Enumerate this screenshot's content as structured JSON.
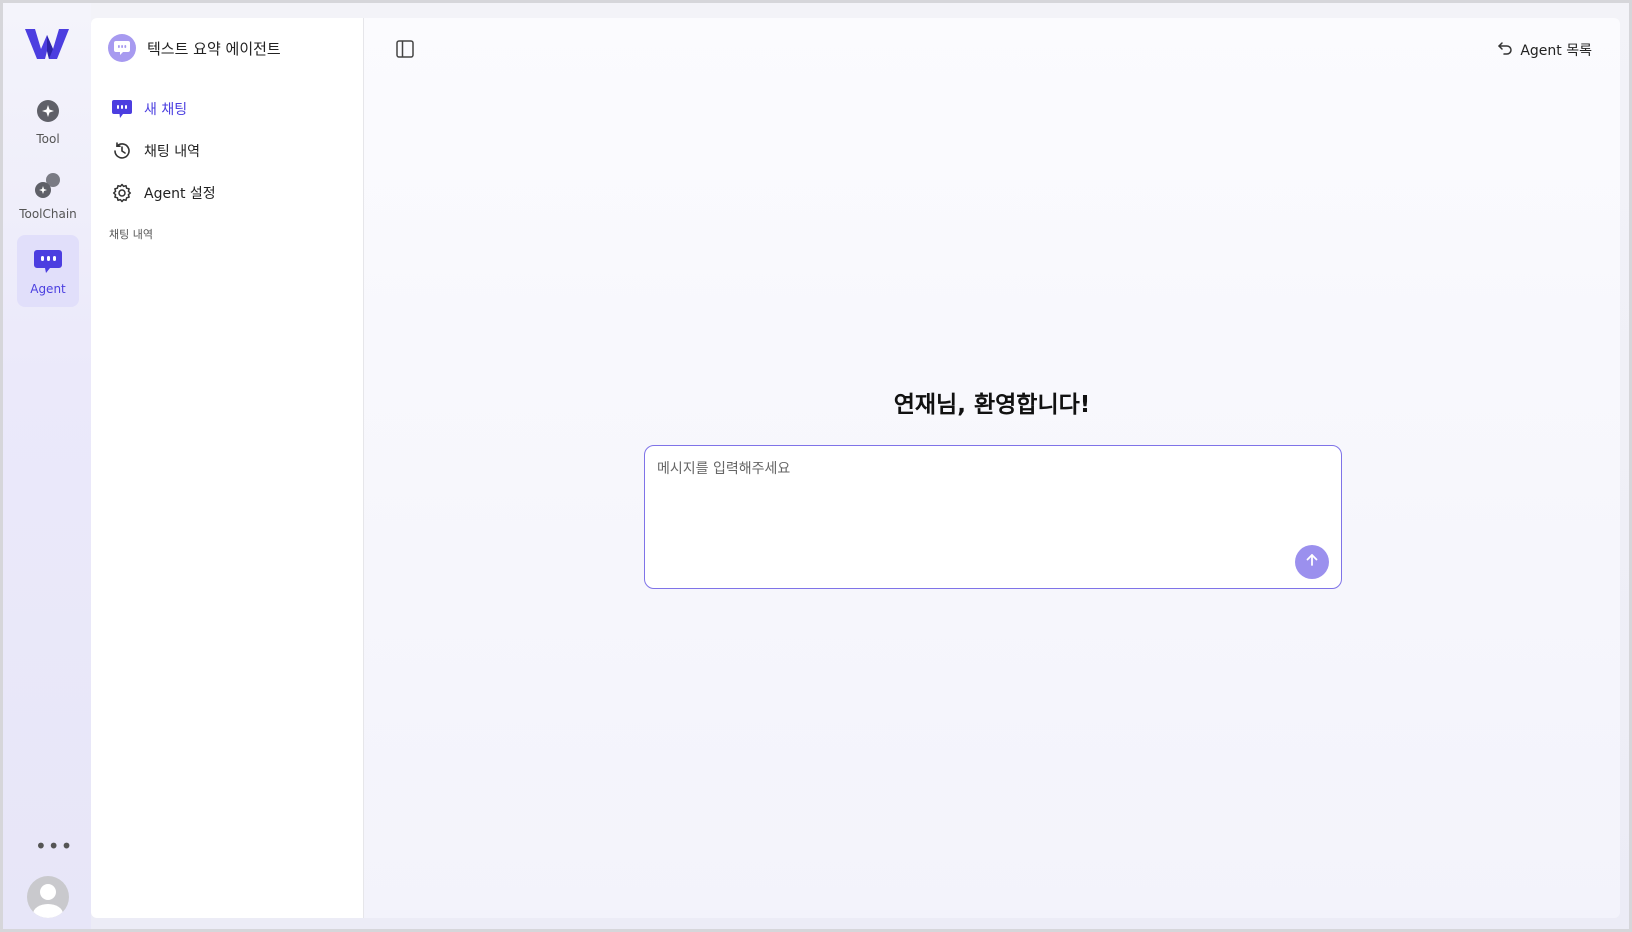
{
  "rail": {
    "logo_icon": "w-logo-icon",
    "items": [
      {
        "label": "Tool",
        "icon": "tool-icon"
      },
      {
        "label": "ToolChain",
        "icon": "toolchain-icon"
      },
      {
        "label": "Agent",
        "icon": "agent-icon",
        "active": true
      }
    ],
    "more_label": "•••"
  },
  "panel": {
    "agent_title": "텍스트 요약 에이전트",
    "nav": [
      {
        "label": "새 채팅",
        "icon": "new-chat-icon",
        "active": true
      },
      {
        "label": "채팅 내역",
        "icon": "history-icon"
      },
      {
        "label": "Agent 설정",
        "icon": "gear-icon"
      }
    ],
    "section_label": "채팅 내역"
  },
  "header": {
    "back_label": "Agent 목록"
  },
  "main": {
    "welcome": "연재님, 환영합니다!",
    "input_placeholder": "메시지를 입력해주세요",
    "input_value": ""
  },
  "colors": {
    "accent": "#4b3fe0",
    "send_button": "#9b90ee",
    "input_border": "#7f73e8"
  }
}
